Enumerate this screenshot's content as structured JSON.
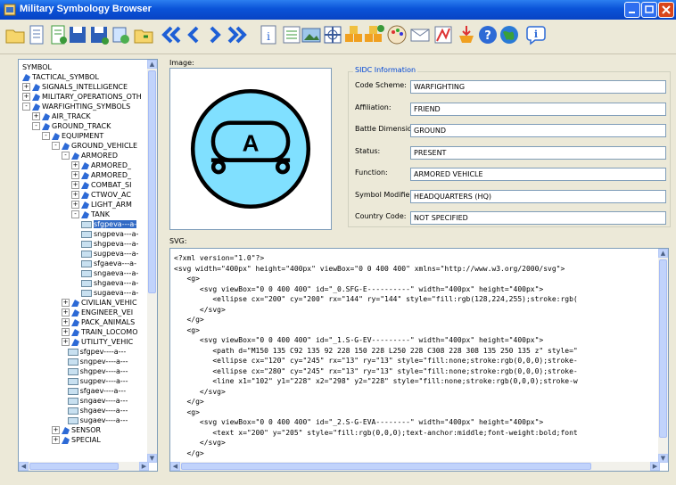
{
  "window": {
    "title": "Military Symbology Browser"
  },
  "toolbar": {
    "icons": [
      "open-folder-icon",
      "document-icon",
      "document-add-icon",
      "save-icon",
      "save-as-icon",
      "refresh-icon",
      "folder-go-icon",
      "first-icon",
      "previous-icon",
      "next-icon",
      "last-icon",
      "info-icon",
      "list-icon",
      "image-icon",
      "grid-icon",
      "blocks-icon",
      "blocks-add-icon",
      "palette-icon",
      "mail-icon",
      "chart-icon",
      "export-icon",
      "help-icon",
      "globe-icon",
      "about-icon"
    ]
  },
  "tree": {
    "rows": [
      {
        "label": "SYMBOL",
        "indent": 0,
        "expander": "",
        "icon": "none"
      },
      {
        "label": "TACTICAL_SYMBOL",
        "indent": 0,
        "expander": "",
        "icon": "node"
      },
      {
        "label": "SIGNALS_INTELLIGENCE",
        "indent": 0,
        "expander": "+",
        "icon": "node"
      },
      {
        "label": "MILITARY_OPERATIONS_OTH",
        "indent": 0,
        "expander": "+",
        "icon": "node"
      },
      {
        "label": "WARFIGHTING_SYMBOLS",
        "indent": 0,
        "expander": "-",
        "icon": "node"
      },
      {
        "label": "AIR_TRACK",
        "indent": 1,
        "expander": "+",
        "icon": "node"
      },
      {
        "label": "GROUND_TRACK",
        "indent": 1,
        "expander": "-",
        "icon": "node"
      },
      {
        "label": "EQUIPMENT",
        "indent": 2,
        "expander": "-",
        "icon": "node"
      },
      {
        "label": "GROUND_VEHICLE",
        "indent": 3,
        "expander": "-",
        "icon": "node"
      },
      {
        "label": "ARMORED",
        "indent": 4,
        "expander": "-",
        "icon": "node"
      },
      {
        "label": "ARMORED_",
        "indent": 5,
        "expander": "+",
        "icon": "node"
      },
      {
        "label": "ARMORED_",
        "indent": 5,
        "expander": "+",
        "icon": "node"
      },
      {
        "label": "COMBAT_SI",
        "indent": 5,
        "expander": "+",
        "icon": "node"
      },
      {
        "label": "CTWOV_AC",
        "indent": 5,
        "expander": "+",
        "icon": "node"
      },
      {
        "label": "LIGHT_ARM",
        "indent": 5,
        "expander": "+",
        "icon": "node"
      },
      {
        "label": "TANK",
        "indent": 5,
        "expander": "-",
        "icon": "node"
      },
      {
        "label": "sfgpeva---a-",
        "indent": 6,
        "expander": "",
        "icon": "leaf",
        "selected": true
      },
      {
        "label": "sngpeva---a-",
        "indent": 6,
        "expander": "",
        "icon": "leaf"
      },
      {
        "label": "shgpeva---a-",
        "indent": 6,
        "expander": "",
        "icon": "leaf"
      },
      {
        "label": "sugpeva---a-",
        "indent": 6,
        "expander": "",
        "icon": "leaf"
      },
      {
        "label": "sfgaeva---a-",
        "indent": 6,
        "expander": "",
        "icon": "leaf"
      },
      {
        "label": "sngaeva---a-",
        "indent": 6,
        "expander": "",
        "icon": "leaf"
      },
      {
        "label": "shgaeva---a-",
        "indent": 6,
        "expander": "",
        "icon": "leaf"
      },
      {
        "label": "sugaeva---a-",
        "indent": 6,
        "expander": "",
        "icon": "leaf"
      },
      {
        "label": "CIVILIAN_VEHIC",
        "indent": 4,
        "expander": "+",
        "icon": "node"
      },
      {
        "label": "ENGINEER_VEI",
        "indent": 4,
        "expander": "+",
        "icon": "node"
      },
      {
        "label": "PACK_ANIMALS",
        "indent": 4,
        "expander": "+",
        "icon": "node"
      },
      {
        "label": "TRAIN_LOCOMO",
        "indent": 4,
        "expander": "+",
        "icon": "node"
      },
      {
        "label": "UTILITY_VEHIC",
        "indent": 4,
        "expander": "+",
        "icon": "node"
      },
      {
        "label": "sfgpev----a---",
        "indent": 4.6,
        "expander": "",
        "icon": "leaf"
      },
      {
        "label": "sngpev----a---",
        "indent": 4.6,
        "expander": "",
        "icon": "leaf"
      },
      {
        "label": "shgpev----a---",
        "indent": 4.6,
        "expander": "",
        "icon": "leaf"
      },
      {
        "label": "sugpev----a---",
        "indent": 4.6,
        "expander": "",
        "icon": "leaf"
      },
      {
        "label": "sfgaev----a---",
        "indent": 4.6,
        "expander": "",
        "icon": "leaf"
      },
      {
        "label": "sngaev----a---",
        "indent": 4.6,
        "expander": "",
        "icon": "leaf"
      },
      {
        "label": "shgaev----a---",
        "indent": 4.6,
        "expander": "",
        "icon": "leaf"
      },
      {
        "label": "sugaev----a---",
        "indent": 4.6,
        "expander": "",
        "icon": "leaf"
      },
      {
        "label": "SENSOR",
        "indent": 3,
        "expander": "+",
        "icon": "node"
      },
      {
        "label": "SPECIAL",
        "indent": 3,
        "expander": "+",
        "icon": "node"
      }
    ]
  },
  "image": {
    "label": "Image:",
    "symbol_letter": "A",
    "fill_color": "#80e0ff"
  },
  "sidc": {
    "title": "SIDC Information",
    "fields": [
      {
        "label": "Code Scheme:",
        "value": "WARFIGHTING"
      },
      {
        "label": "Affiliation:",
        "value": "FRIEND"
      },
      {
        "label": "Battle Dimension:",
        "value": "GROUND"
      },
      {
        "label": "Status:",
        "value": "PRESENT"
      },
      {
        "label": "Function:",
        "value": "ARMORED VEHICLE"
      },
      {
        "label": "Symbol Modifier:",
        "value": "HEADQUARTERS (HQ)"
      },
      {
        "label": "Country Code:",
        "value": "NOT SPECIFIED"
      }
    ]
  },
  "svg_panel": {
    "label": "SVG:",
    "lines": [
      "<?xml version=\"1.0\"?>",
      "<svg width=\"400px\" height=\"400px\" viewBox=\"0 0 400 400\" xmlns=\"http://www.w3.org/2000/svg\">",
      "   <g>",
      "      <svg viewBox=\"0 0 400 400\" id=\"_0.SFG-E----------\" width=\"400px\" height=\"400px\">",
      "         <ellipse cx=\"200\" cy=\"200\" rx=\"144\" ry=\"144\" style=\"fill:rgb(128,224,255);stroke:rgb(",
      "      </svg>",
      "   </g>",
      "   <g>",
      "      <svg viewBox=\"0 0 400 400\" id=\"_1.S-G-EV---------\" width=\"400px\" height=\"400px\">",
      "         <path d=\"M150 135 C92 135 92 228 150 228 L250 228 C308 228 308 135 250 135 z\" style=\"",
      "         <ellipse cx=\"120\" cy=\"245\" rx=\"13\" ry=\"13\" style=\"fill:none;stroke:rgb(0,0,0);stroke-",
      "         <ellipse cx=\"280\" cy=\"245\" rx=\"13\" ry=\"13\" style=\"fill:none;stroke:rgb(0,0,0);stroke-",
      "         <line x1=\"102\" y1=\"228\" x2=\"298\" y2=\"228\" style=\"fill:none;stroke:rgb(0,0,0);stroke-w",
      "      </svg>",
      "   </g>",
      "   <g>",
      "      <svg viewBox=\"0 0 400 400\" id=\"_2.S-G-EVA--------\" width=\"400px\" height=\"400px\">",
      "         <text x=\"200\" y=\"205\" style=\"fill:rgb(0,0,0);text-anchor:middle;font-weight:bold;font",
      "      </svg>",
      "   </g>"
    ]
  }
}
